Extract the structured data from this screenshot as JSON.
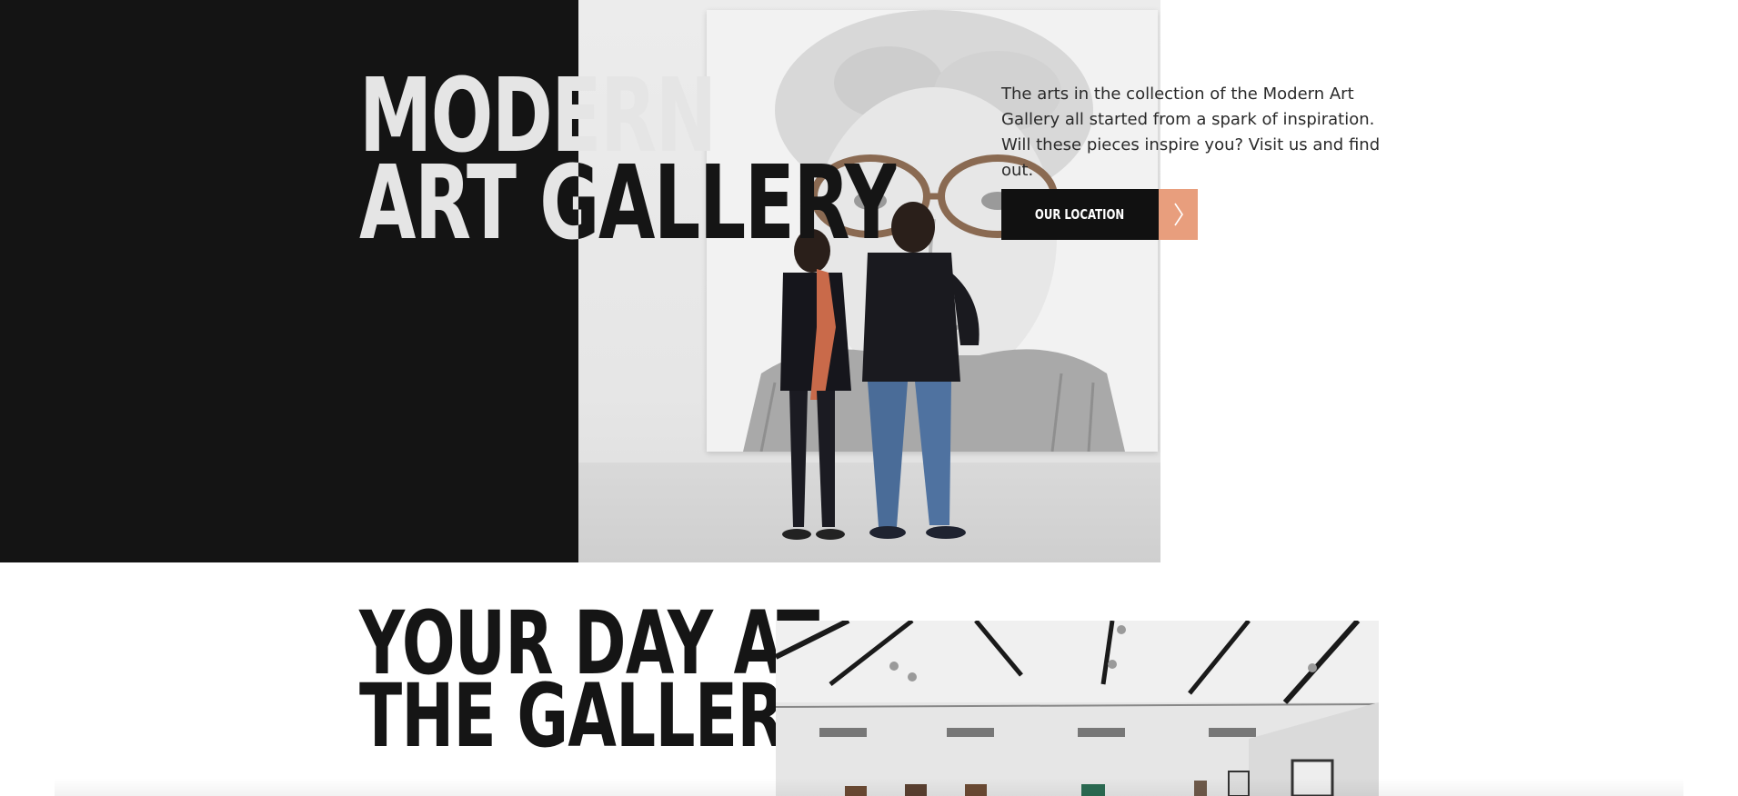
{
  "hero": {
    "title_line1": "MODERN",
    "title_line2": "ART GALLERY",
    "description": "The arts in the collection of the Modern Art Gallery all started from a spark of inspiration. Will these pieces inspire you? Visit us and find out.",
    "cta_label": "OUR LOCATION",
    "cta_icon": "chevron-right-icon",
    "photo_alt": "Two visitors looking at a large portrait painting"
  },
  "section": {
    "title_line1": "YOUR DAY AT",
    "title_line2": "THE GALLERY",
    "photo_alt": "Gallery interior with track lighting"
  },
  "colors": {
    "dark": "#141414",
    "accent": "#e89e7d",
    "text": "#2a2a2a",
    "background": "#ffffff"
  }
}
